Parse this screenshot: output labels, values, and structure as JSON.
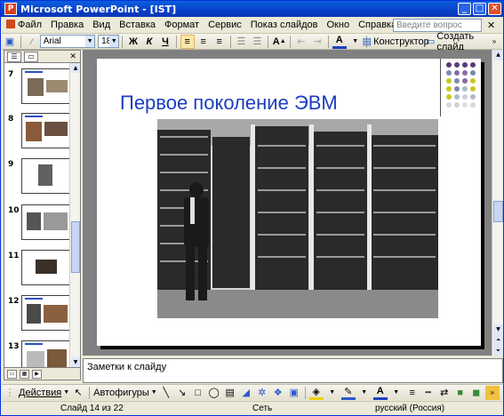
{
  "window": {
    "title": "Microsoft PowerPoint - [IST]"
  },
  "menu": {
    "items": [
      "Файл",
      "Правка",
      "Вид",
      "Вставка",
      "Формат",
      "Сервис",
      "Показ слайдов",
      "Окно",
      "Справка"
    ],
    "ask_placeholder": "Введите вопрос"
  },
  "toolbar": {
    "font_name": "Arial",
    "font_size": "18",
    "bold": "Ж",
    "italic": "К",
    "underline": "Ч",
    "designer_label": "Конструктор",
    "new_slide_label": "Создать слайд"
  },
  "thumbnails": [
    {
      "number": "7"
    },
    {
      "number": "8"
    },
    {
      "number": "9"
    },
    {
      "number": "10"
    },
    {
      "number": "11"
    },
    {
      "number": "12"
    },
    {
      "number": "13"
    }
  ],
  "slide": {
    "title": "Первое поколение ЭВМ",
    "accent_color": "#1c3ec0"
  },
  "notes": {
    "placeholder": "Заметки к слайду"
  },
  "drawing": {
    "actions_label": "Действия",
    "autoshapes_label": "Автофигуры"
  },
  "status": {
    "slide_info": "Слайд 14 из 22",
    "design": "Сеть",
    "language": "русский (Россия)"
  }
}
